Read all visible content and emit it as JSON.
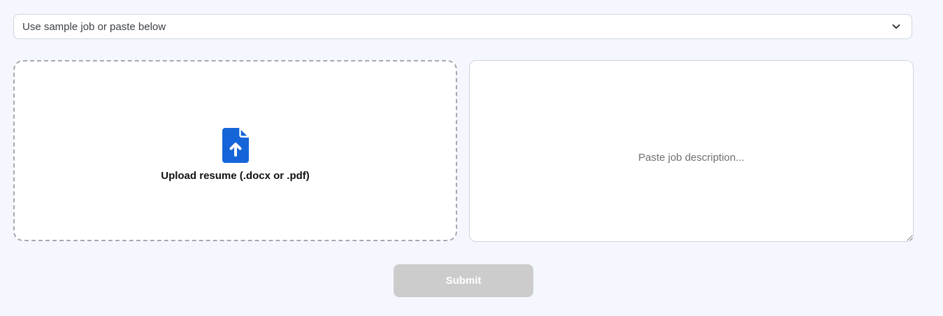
{
  "job_select": {
    "selected": "Use sample job or paste below",
    "icon": "chevron-down-icon"
  },
  "upload": {
    "label": "Upload resume (.docx or .pdf)",
    "icon": "file-upload-icon",
    "icon_color": "#1565d8"
  },
  "job_description": {
    "placeholder": "Paste job description..."
  },
  "submit": {
    "label": "Submit",
    "background": "#cccccc",
    "disabled": true
  }
}
